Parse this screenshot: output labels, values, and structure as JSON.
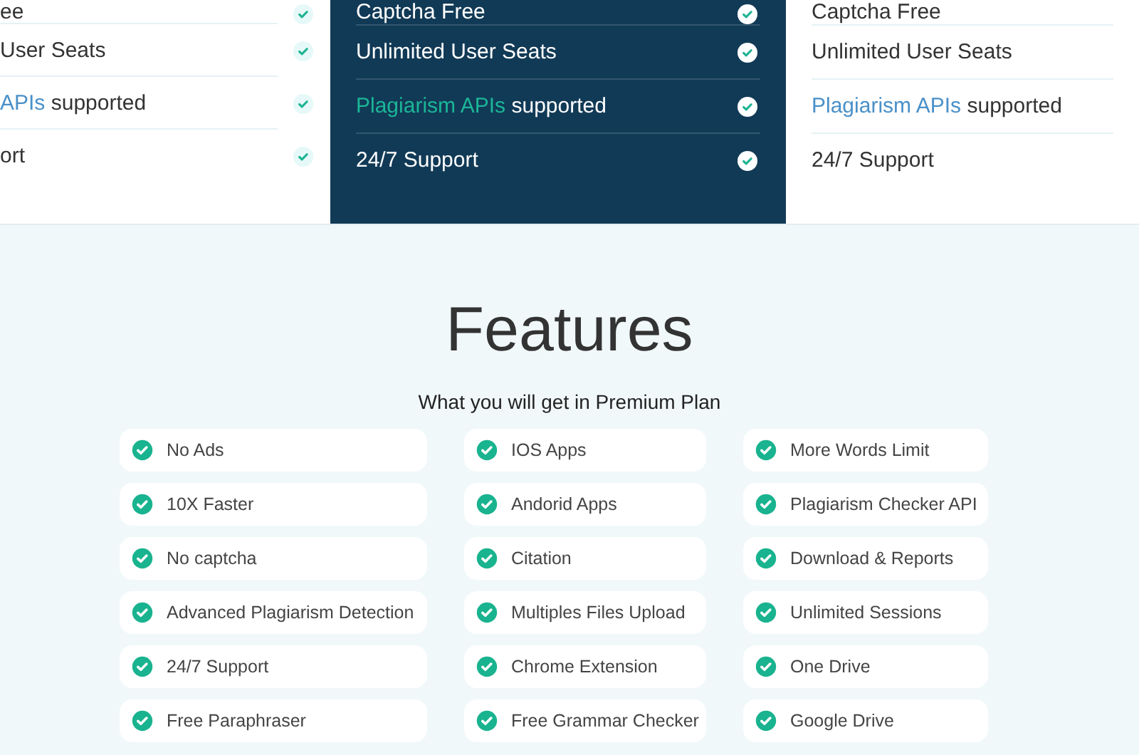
{
  "plans": [
    {
      "dark": false,
      "show_checks": true,
      "features": [
        {
          "text": "ee"
        },
        {
          "text": "User Seats"
        },
        {
          "highlight": "APIs",
          "text": "supported"
        },
        {
          "text": "ort"
        }
      ]
    },
    {
      "dark": true,
      "show_checks": true,
      "features": [
        {
          "text": "Captcha Free"
        },
        {
          "text": "Unlimited User Seats"
        },
        {
          "highlight": "Plagiarism APIs",
          "text": "supported"
        },
        {
          "text": "24/7 Support"
        }
      ]
    },
    {
      "dark": false,
      "show_checks": false,
      "features": [
        {
          "text": "Captcha Free"
        },
        {
          "text": "Unlimited User Seats"
        },
        {
          "highlight": "Plagiarism APIs",
          "text": "supported"
        },
        {
          "text": "24/7 Support"
        }
      ]
    }
  ],
  "features_section": {
    "title": "Features",
    "subtitle": "What you will get in Premium Plan",
    "columns": [
      [
        "No Ads",
        "10X Faster",
        "No captcha",
        "Advanced Plagiarism Detection",
        "24/7 Support",
        "Free Paraphraser"
      ],
      [
        "IOS Apps",
        "Andorid Apps",
        "Citation",
        "Multiples Files Upload",
        "Chrome Extension",
        "Free Grammar Checker"
      ],
      [
        "More Words Limit",
        "Plagiarism Checker API",
        "Download & Reports",
        "Unlimited Sessions",
        "One Drive",
        "Google Drive"
      ]
    ]
  }
}
